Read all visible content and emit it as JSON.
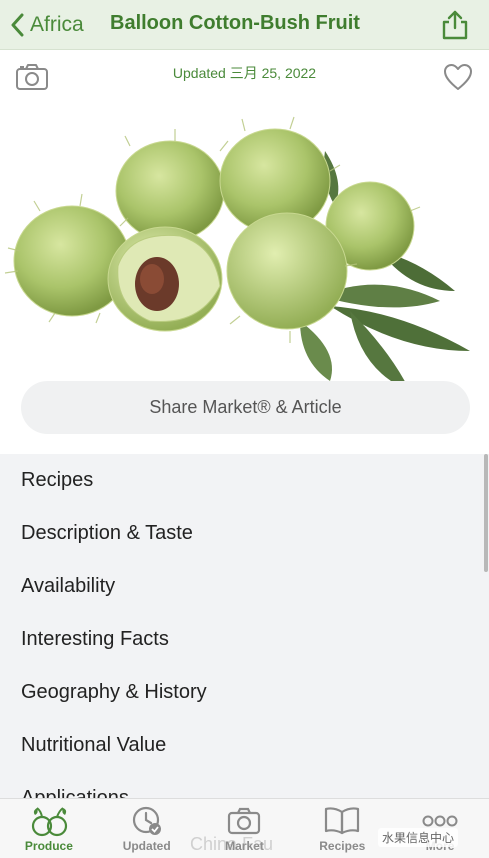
{
  "nav": {
    "back_label": "Africa",
    "title": "Balloon Cotton-Bush Fruit"
  },
  "hero": {
    "updated_text": "Updated 三月 25, 2022"
  },
  "share_button_label": "Share Market® & Article",
  "sections": [
    "Recipes",
    "Description & Taste",
    "Availability",
    "Interesting Facts",
    "Geography & History",
    "Nutritional Value",
    "Applications"
  ],
  "tabs": [
    {
      "label": "Produce",
      "icon": "produce-icon",
      "active": true
    },
    {
      "label": "Updated",
      "icon": "updated-clock-icon",
      "active": false
    },
    {
      "label": "Market",
      "icon": "market-camera-icon",
      "active": false
    },
    {
      "label": "Recipes",
      "icon": "book-icon",
      "active": false
    },
    {
      "label": "More",
      "icon": "more-icon",
      "active": false
    }
  ],
  "watermarks": {
    "channel": "水果信息中心",
    "site": "China Fau"
  },
  "colors": {
    "accent": "#4a8a3a",
    "nav_bg": "#e8f1e4",
    "list_bg": "#f2f3f5"
  }
}
